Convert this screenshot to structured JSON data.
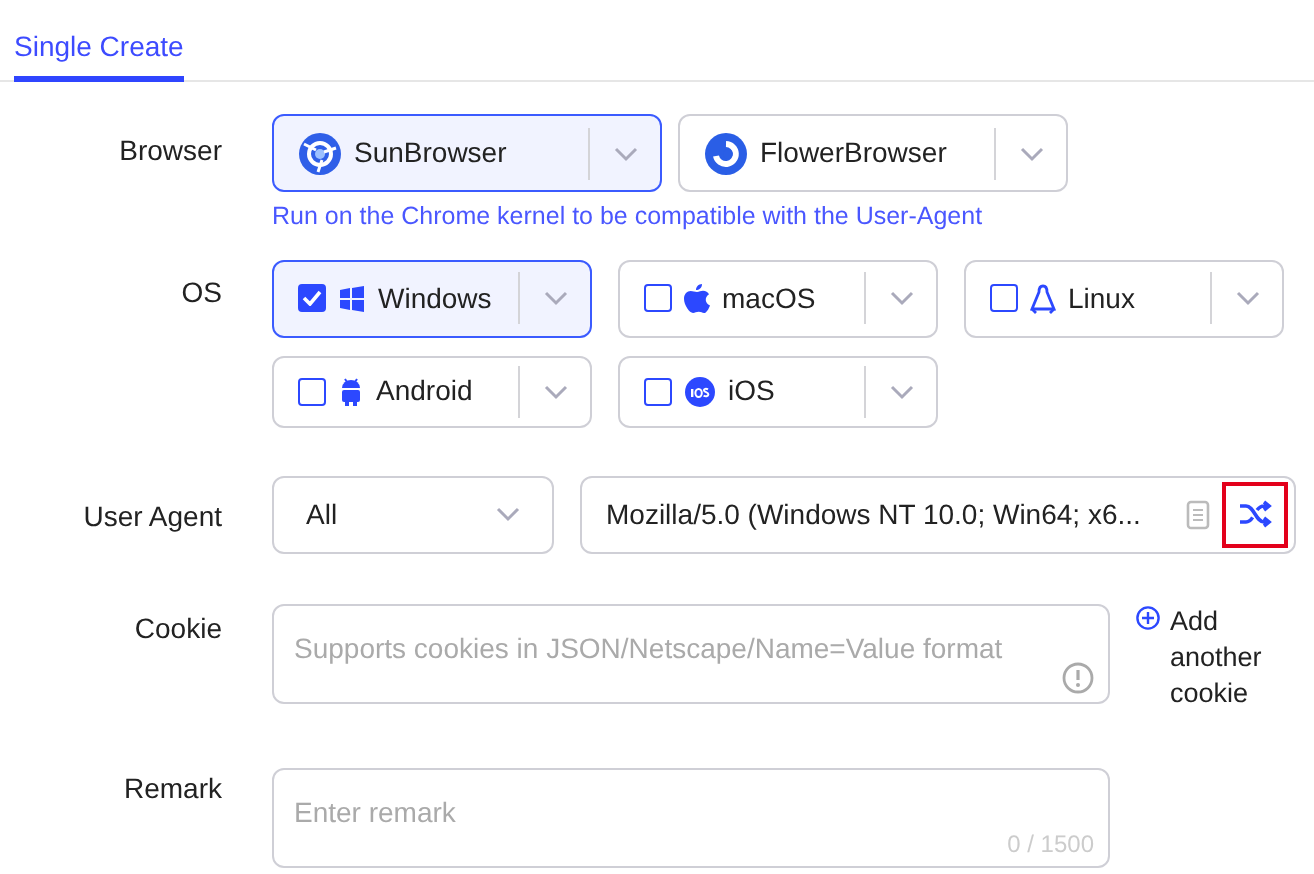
{
  "tabs": [
    {
      "label": "Single Create",
      "selected": true
    }
  ],
  "browser": {
    "label": "Browser",
    "options": [
      {
        "name": "SunBrowser",
        "selected": true,
        "kind": "sun"
      },
      {
        "name": "FlowerBrowser",
        "selected": false,
        "kind": "flower"
      }
    ],
    "hint": "Run on the Chrome kernel to be compatible with the User-Agent"
  },
  "os": {
    "label": "OS",
    "options": [
      {
        "name": "Windows",
        "checked": true,
        "kind": "windows"
      },
      {
        "name": "macOS",
        "checked": false,
        "kind": "apple"
      },
      {
        "name": "Linux",
        "checked": false,
        "kind": "linux"
      },
      {
        "name": "Android",
        "checked": false,
        "kind": "android"
      },
      {
        "name": "iOS",
        "checked": false,
        "kind": "ios"
      }
    ]
  },
  "user_agent": {
    "label": "User Agent",
    "filter": "All",
    "value": "Mozilla/5.0 (Windows NT 10.0; Win64; x6...",
    "shuffle_highlighted": true
  },
  "cookie": {
    "label": "Cookie",
    "placeholder": "Supports cookies in JSON/Netscape/Name=Value format",
    "add_link": "Add another cookie"
  },
  "remark": {
    "label": "Remark",
    "placeholder": "Enter remark",
    "counter": "0 / 1500"
  }
}
